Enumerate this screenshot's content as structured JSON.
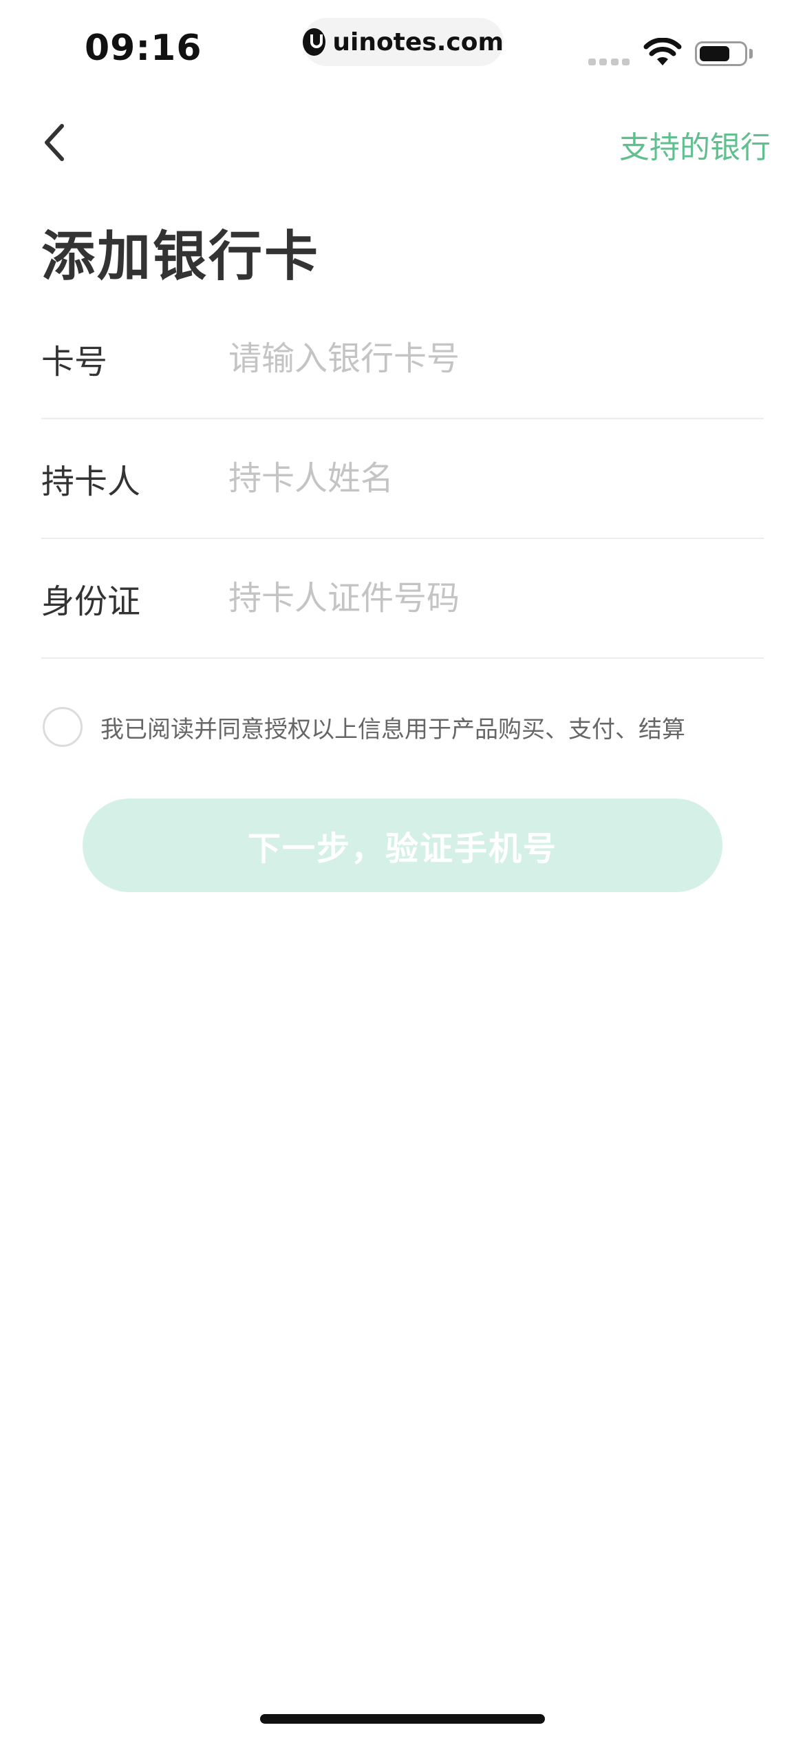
{
  "status_bar": {
    "time": "09:16",
    "url": "uinotes.com"
  },
  "nav": {
    "right_link": "支持的银行"
  },
  "page": {
    "title": "添加银行卡"
  },
  "form": {
    "card_number": {
      "label": "卡号",
      "placeholder": "请输入银行卡号",
      "value": ""
    },
    "cardholder": {
      "label": "持卡人",
      "placeholder": "持卡人姓名",
      "value": ""
    },
    "id_card": {
      "label": "身份证",
      "placeholder": "持卡人证件号码",
      "value": ""
    }
  },
  "agreement": {
    "text": "我已阅读并同意授权以上信息用于产品购买、支付、结算",
    "checked": false
  },
  "next_button": {
    "label": "下一步，验证手机号"
  },
  "colors": {
    "accent": "#5fbf8e",
    "button_disabled_bg": "#d5f0e6",
    "title_text": "#333333",
    "placeholder": "#c4c4c4",
    "divider": "#ececec"
  },
  "icons": {
    "back": "chevron-left-icon",
    "wifi": "wifi-icon",
    "battery": "battery-icon",
    "signal": "signal-icon",
    "site": "uinotes-logo-icon"
  }
}
